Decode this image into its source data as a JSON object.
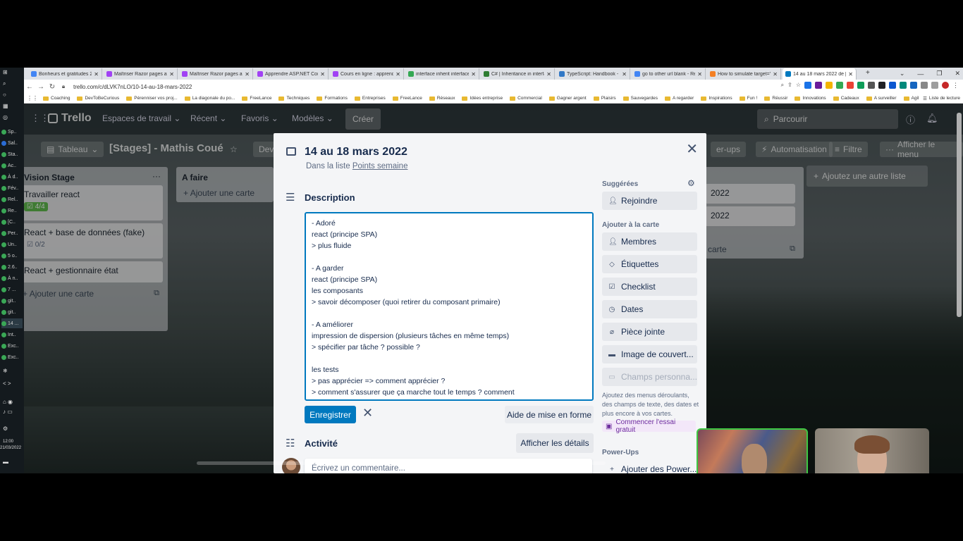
{
  "browser": {
    "tabs": [
      {
        "label": "Bonheurs et gratitudes 20",
        "color": "#4285f4"
      },
      {
        "label": "Maîtriser Razor pages ave",
        "color": "#a142f4"
      },
      {
        "label": "Maîtriser Razor pages ave",
        "color": "#a142f4"
      },
      {
        "label": "Apprendre ASP.NET Core",
        "color": "#a142f4"
      },
      {
        "label": "Cours en ligne : apprend",
        "color": "#a142f4"
      },
      {
        "label": "interface inherit interface",
        "color": "#34a853"
      },
      {
        "label": "C# | Inheritance in interfa",
        "color": "#2e7d32"
      },
      {
        "label": "TypeScript: Handbook - In",
        "color": "#3178c6"
      },
      {
        "label": "go to other url blank - Re",
        "color": "#4285f4"
      },
      {
        "label": "How to simulate target=\"",
        "color": "#f48024"
      },
      {
        "label": "14 au 18 mars 2022 de [S",
        "color": "#0079bf",
        "active": true
      }
    ],
    "url": "trello.com/c/dLVK7nLO/10-14-au-18-mars-2022",
    "bookmarks": [
      "Coaching",
      "DevToBeCurious",
      "Pérenniser vos proj...",
      "La diagonale du po...",
      "FreeLance",
      "Techniques",
      "Formations",
      "Entreprises",
      "FreeLance",
      "Réseaux",
      "Idées entreprise",
      "Commercial",
      "Gagner argent",
      "Plaisirs",
      "Sauvegardes",
      "A regarder",
      "Inspirations",
      "Fun !",
      "Réussir",
      "Innovations",
      "Cadeaux",
      "A surveiller",
      "Agilité",
      "Startups"
    ],
    "reading_list": "Liste de lecture"
  },
  "taskbar": {
    "items": [
      "Sp..",
      "Sal..",
      "Sta..",
      "Ac..",
      "À d..",
      "Fév..",
      "Rel..",
      "Re..",
      "[C..",
      "Per..",
      "Un..",
      "5 o..",
      "2.6..",
      "À n..",
      "7 ...",
      "git..",
      "git..",
      "14 ...",
      "Int..",
      "Exc..",
      "Exc.."
    ],
    "time": "12:00",
    "date": "21/03/2022"
  },
  "trello": {
    "brand": "Trello",
    "nav": [
      "Espaces de travail",
      "Récent",
      "Favoris",
      "Modèles"
    ],
    "create": "Créer",
    "search_placeholder": "Parcourir",
    "board": {
      "view": "Tableau",
      "title": "[Stages] - Mathis Coué",
      "partial_dev": "Dev",
      "powerups_partial": "er-ups",
      "automation": "Automatisation",
      "filter": "Filtre",
      "show_menu": "Afficher le menu"
    },
    "lists": [
      {
        "title": "Vision Stage",
        "cards": [
          {
            "text": "Travailler react",
            "badge": "4/4"
          },
          {
            "text": "React + base de données (fake)",
            "badge": "0/2"
          },
          {
            "text": "React + gestionnaire état",
            "badge": ""
          }
        ],
        "add": "Ajouter une carte"
      },
      {
        "title": "A faire",
        "cards": [],
        "add": "Ajouter une carte"
      }
    ],
    "right_list": {
      "cards": [
        "2022",
        "2022"
      ],
      "add_partial": "carte"
    },
    "add_list": "Ajoutez une autre liste"
  },
  "modal": {
    "title": "14 au 18 mars 2022",
    "in_list_prefix": "Dans la liste",
    "in_list_name": "Points semaine",
    "description_label": "Description",
    "description_text": "- Adoré\nreact (principe SPA)\n> plus fluide\n\n- A garder\nreact (principe SPA)\nles composants\n> savoir décomposer (quoi retirer du composant primaire)\n\n- A améliorer\nimpression de dispersion (plusieurs tâches en même temps)\n> spécifier par tâche ? possible ?\n\nles tests\n> pas apprécier => comment apprécier ?\n> comment s'assurer que ça marche tout le temps ? comment ",
    "save": "Enregistrer",
    "format_help": "Aide de mise en forme",
    "activity_label": "Activité",
    "show_details": "Afficher les détails",
    "comment_placeholder": "Écrivez un commentaire...",
    "sidebar": {
      "suggested": "Suggérées",
      "join": "Rejoindre",
      "add_to_card": "Ajouter à la carte",
      "members": "Membres",
      "labels": "Étiquettes",
      "checklist": "Checklist",
      "dates": "Dates",
      "attachment": "Pièce jointe",
      "cover": "Image de couvert...",
      "custom_fields": "Champs personna...",
      "upsell": "Ajoutez des menus déroulants, des champs de texte, des dates et plus encore à vos cartes.",
      "trial": "Commencer l'essai gratuit",
      "powerups_label": "Power-Ups",
      "add_powerups": "Ajouter des Power..."
    }
  }
}
